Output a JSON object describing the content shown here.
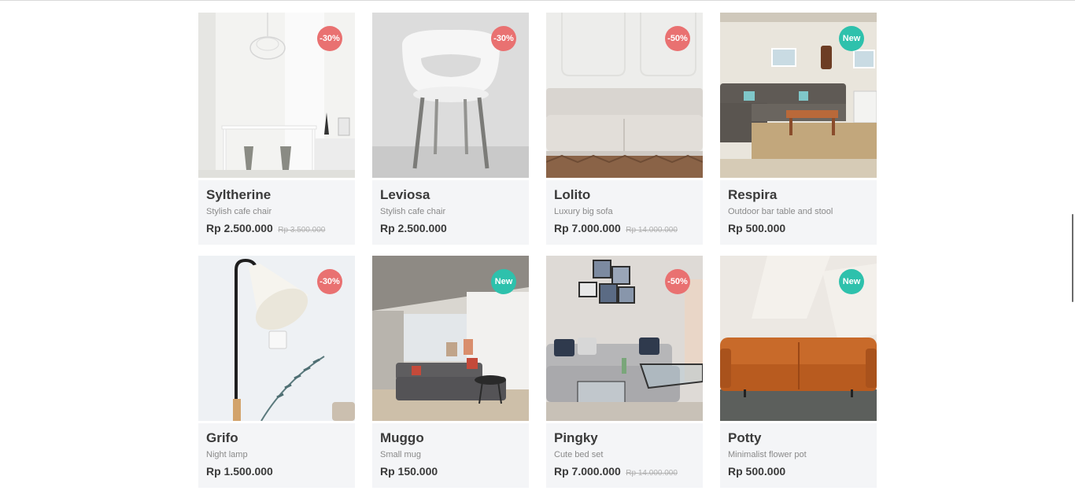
{
  "products": [
    {
      "name": "Syltherine",
      "desc": "Stylish cafe chair",
      "price": "Rp 2.500.000",
      "old_price": "Rp 3.500.000",
      "badge": "-30%",
      "badge_type": "sale"
    },
    {
      "name": "Leviosa",
      "desc": "Stylish cafe chair",
      "price": "Rp 2.500.000",
      "old_price": "",
      "badge": "-30%",
      "badge_type": "sale"
    },
    {
      "name": "Lolito",
      "desc": "Luxury big sofa",
      "price": "Rp 7.000.000",
      "old_price": "Rp 14.000.000",
      "badge": "-50%",
      "badge_type": "sale"
    },
    {
      "name": "Respira",
      "desc": "Outdoor bar table and stool",
      "price": "Rp 500.000",
      "old_price": "",
      "badge": "New",
      "badge_type": "new"
    },
    {
      "name": "Grifo",
      "desc": "Night lamp",
      "price": "Rp 1.500.000",
      "old_price": "",
      "badge": "-30%",
      "badge_type": "sale"
    },
    {
      "name": "Muggo",
      "desc": "Small mug",
      "price": "Rp 150.000",
      "old_price": "",
      "badge": "New",
      "badge_type": "new"
    },
    {
      "name": "Pingky",
      "desc": "Cute bed set",
      "price": "Rp 7.000.000",
      "old_price": "Rp 14.000.000",
      "badge": "-50%",
      "badge_type": "sale"
    },
    {
      "name": "Potty",
      "desc": "Minimalist flower pot",
      "price": "Rp 500.000",
      "old_price": "",
      "badge": "New",
      "badge_type": "new"
    }
  ],
  "colors": {
    "sale_badge": "#e97171",
    "new_badge": "#2ec1ac",
    "card_bg": "#f4f5f7",
    "title_text": "#3a3a3a",
    "desc_text": "#898989",
    "strike_text": "#b0b0b0"
  }
}
